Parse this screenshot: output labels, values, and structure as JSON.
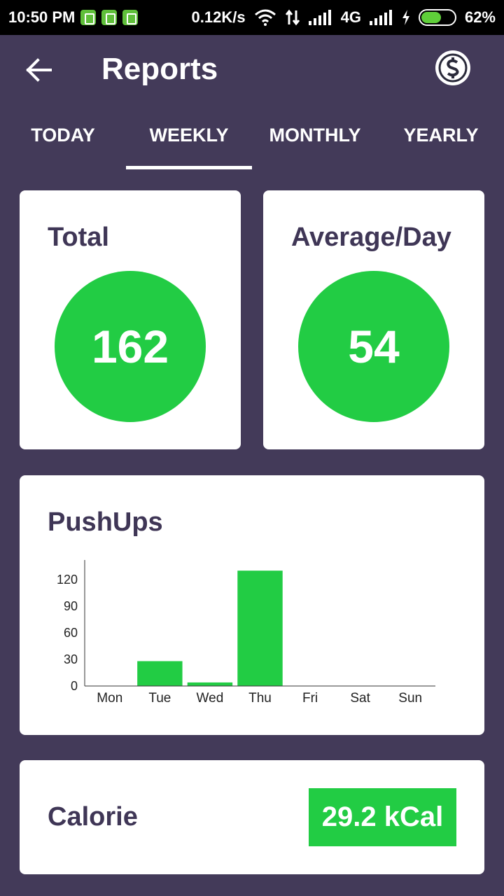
{
  "status_bar": {
    "time": "10:50 PM",
    "net_speed": "0.12K/s",
    "network": "4G",
    "battery": "62%"
  },
  "app_bar": {
    "title": "Reports",
    "back_icon": "arrow-left-icon",
    "coin_icon": "dollar-coin-icon"
  },
  "tabs": [
    {
      "label": "TODAY"
    },
    {
      "label": "WEEKLY",
      "active": true
    },
    {
      "label": "MONTHLY"
    },
    {
      "label": "YEARLY"
    }
  ],
  "total_card": {
    "title": "Total",
    "value": "162"
  },
  "average_card": {
    "title": "Average/Day",
    "value": "54"
  },
  "chart_card": {
    "title": "PushUps"
  },
  "calorie_card": {
    "label": "Calorie",
    "value": "29.2 kCal"
  },
  "colors": {
    "accent": "#22CC44",
    "background": "#433A59",
    "text_dark": "#3F3656"
  },
  "chart_data": {
    "type": "bar",
    "title": "PushUps",
    "categories": [
      "Mon",
      "Tue",
      "Wed",
      "Thu",
      "Fri",
      "Sat",
      "Sun"
    ],
    "values": [
      0,
      28,
      4,
      130,
      0,
      0,
      0
    ],
    "yticks": [
      0,
      30,
      60,
      90,
      120
    ],
    "ylim": [
      0,
      142
    ],
    "grid": false
  }
}
